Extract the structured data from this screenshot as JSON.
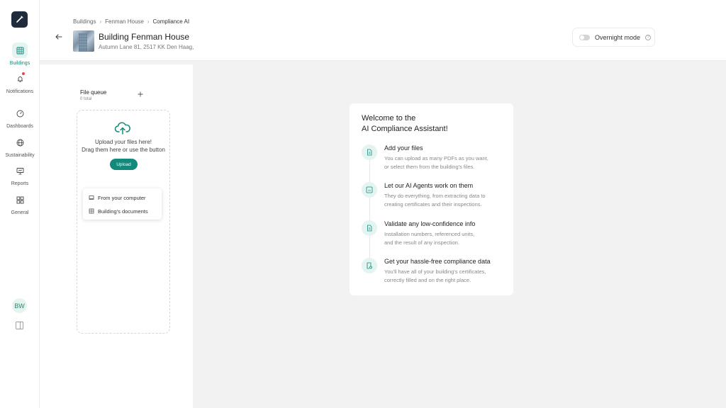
{
  "sidebar": {
    "items": [
      {
        "label": "Buildings",
        "icon": "grid-icon",
        "active": true
      },
      {
        "label": "Notifications",
        "icon": "bell-icon"
      },
      {
        "label": "Dashboards",
        "icon": "gauge-icon"
      },
      {
        "label": "Sustainability",
        "icon": "globe-icon"
      },
      {
        "label": "Reports",
        "icon": "presentation-icon"
      },
      {
        "label": "General",
        "icon": "apps-icon"
      }
    ],
    "avatar_initials": "BW"
  },
  "header": {
    "breadcrumb": [
      "Buildings",
      "Fenman House",
      "Compliance AI"
    ],
    "title": "Building Fenman House",
    "address": "Autumn Lane 81,  2517 KK Den Haag,",
    "overnight_label": "Overnight mode",
    "overnight_on": false
  },
  "queue": {
    "title": "File queue",
    "count": "0 total",
    "upload_line1": "Upload your files here!",
    "upload_line2": "Drag them here or use the button",
    "upload_button": "Upload",
    "menu": [
      "From your computer",
      "Building's documents"
    ]
  },
  "welcome": {
    "title_line1": "Welcome to the",
    "title_line2": "AI Compliance Assistant!",
    "steps": [
      {
        "title": "Add your files",
        "desc1": "You can upload as many PDFs as you want,",
        "desc2": "or select them from the building's files."
      },
      {
        "title": "Let our AI Agents work on them",
        "desc1": "They do everything, from extracting data to",
        "desc2": "creating certificates and their inspections."
      },
      {
        "title": "Validate any low-confidence info",
        "desc1": "Installation numbers, referenced units,",
        "desc2": "and the result of any inspection."
      },
      {
        "title": "Get your hassle-free compliance data",
        "desc1": "You'll have all of your building's certificates,",
        "desc2": "correctly filled and on the right place."
      }
    ]
  },
  "colors": {
    "accent": "#12897a",
    "accent_light": "#e4f4f0",
    "sidebar_logo": "#1f2a3a"
  }
}
